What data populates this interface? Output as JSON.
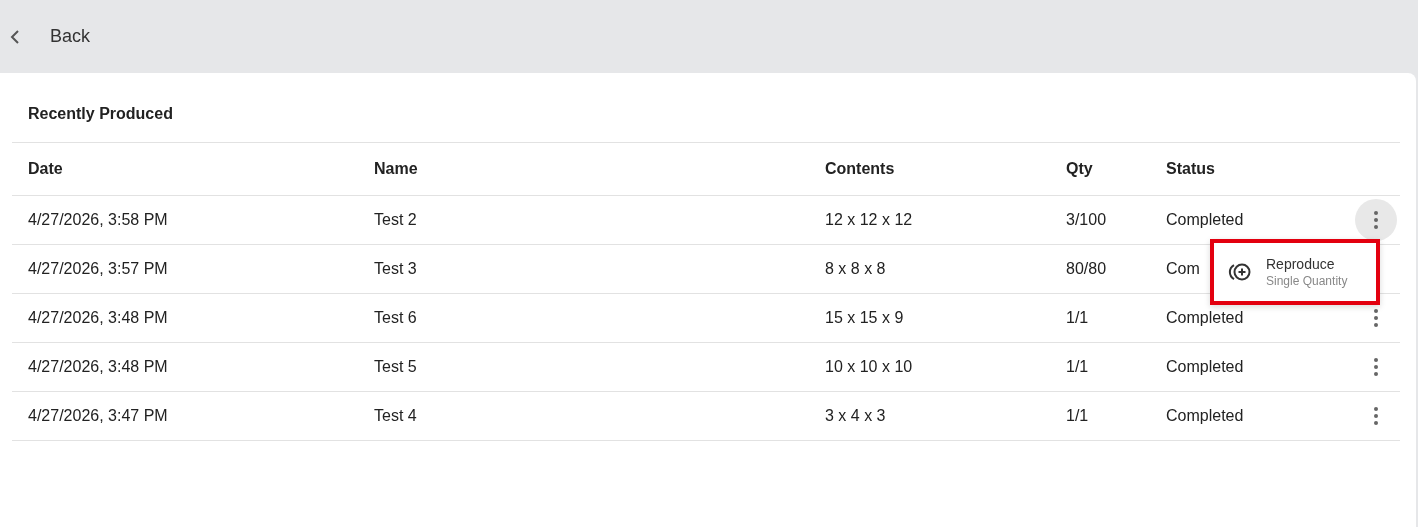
{
  "header": {
    "back_label": "Back"
  },
  "card": {
    "title": "Recently Produced"
  },
  "table": {
    "columns": [
      "Date",
      "Name",
      "Contents",
      "Qty",
      "Status"
    ],
    "rows": [
      {
        "cells": [
          "4/27/2026, 3:58 PM",
          "Test 2",
          "12 x 12 x 12",
          "3/100",
          "Completed"
        ],
        "menu_open": true
      },
      {
        "cells": [
          "4/27/2026, 3:57 PM",
          "Test 3",
          "8 x 8 x 8",
          "80/80",
          "Com"
        ],
        "menu_open": false
      },
      {
        "cells": [
          "4/27/2026, 3:48 PM",
          "Test 6",
          "15 x 15 x 9",
          "1/1",
          "Completed"
        ],
        "menu_open": false
      },
      {
        "cells": [
          "4/27/2026, 3:48 PM",
          "Test 5",
          "10 x 10 x 10",
          "1/1",
          "Completed"
        ],
        "menu_open": false
      },
      {
        "cells": [
          "4/27/2026, 3:47 PM",
          "Test 4",
          "3 x 4 x 3",
          "1/1",
          "Completed"
        ],
        "menu_open": false
      }
    ]
  },
  "menu": {
    "items": [
      {
        "label": "Reproduce",
        "sublabel": "Single Quantity",
        "highlighted": true
      }
    ]
  }
}
